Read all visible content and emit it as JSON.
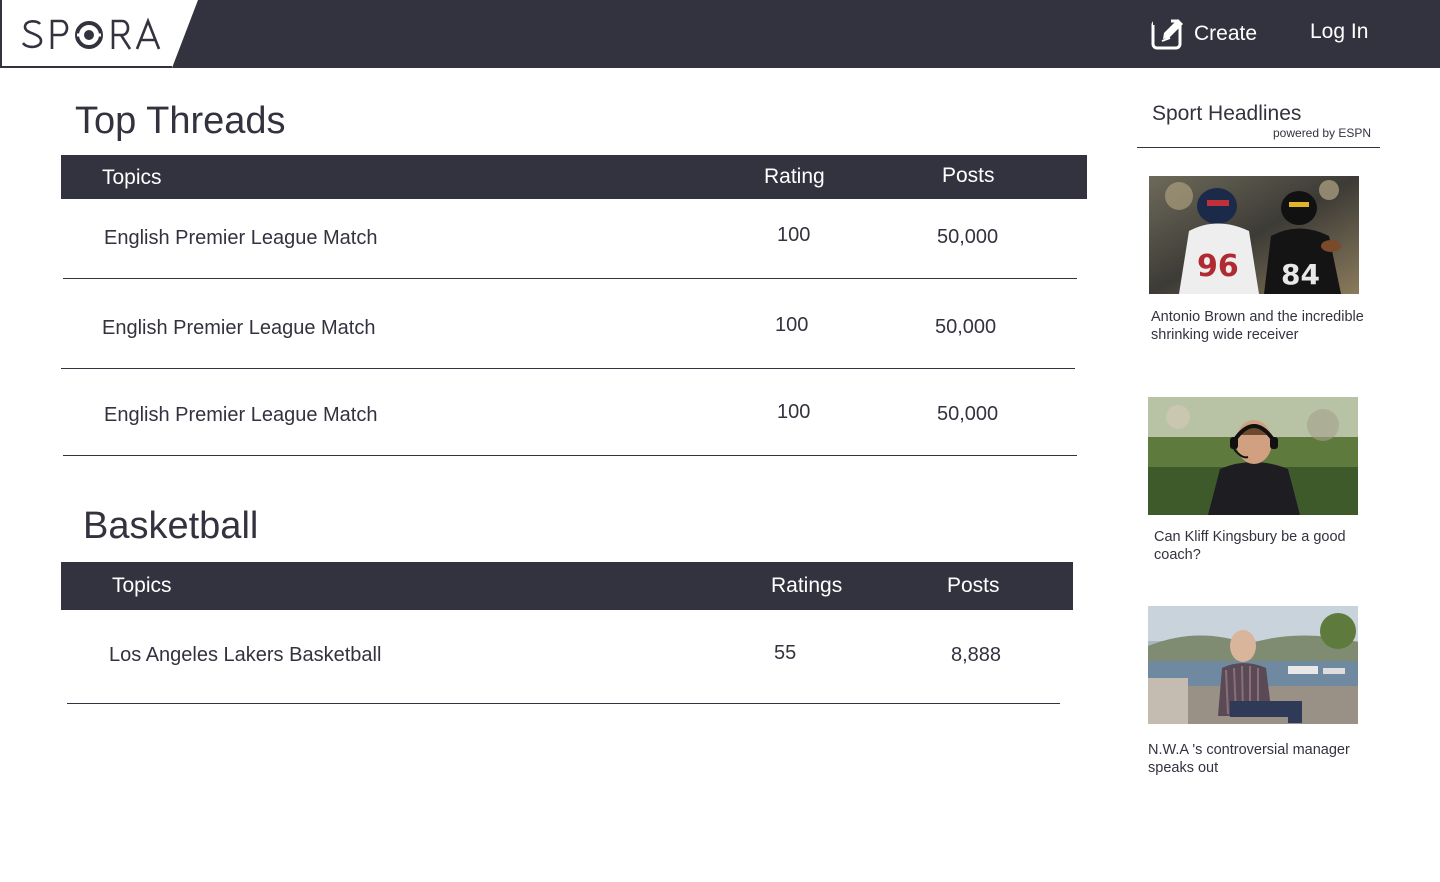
{
  "header": {
    "logo_text": "SPORA",
    "create_label": "Create",
    "login_label": "Log In"
  },
  "top_threads": {
    "title": "Top Threads",
    "columns": [
      "Topics",
      "Rating",
      "Posts"
    ],
    "rows": [
      {
        "topic": "English Premier League Match",
        "rating": "100",
        "posts": "50,000"
      },
      {
        "topic": "English Premier League Match",
        "rating": "100",
        "posts": "50,000"
      },
      {
        "topic": "English Premier League Match",
        "rating": "100",
        "posts": "50,000"
      }
    ]
  },
  "basketball": {
    "title": "Basketball",
    "columns": [
      "Topics",
      "Ratings",
      "Posts"
    ],
    "rows": [
      {
        "topic": "Los Angeles Lakers Basketball",
        "rating": "55",
        "posts": "8,888"
      }
    ]
  },
  "sidebar": {
    "title": "Sport Headlines",
    "powered_by": "powered by ESPN",
    "news": [
      {
        "caption": "Antonio Brown and the incredible shrinking wide receiver"
      },
      {
        "caption": "Can Kliff Kingsbury be a good coach?"
      },
      {
        "caption": "N.W.A 's controversial manager speaks out"
      }
    ]
  },
  "colors": {
    "header_bg": "#33333f",
    "text": "#33333f",
    "white": "#ffffff"
  }
}
